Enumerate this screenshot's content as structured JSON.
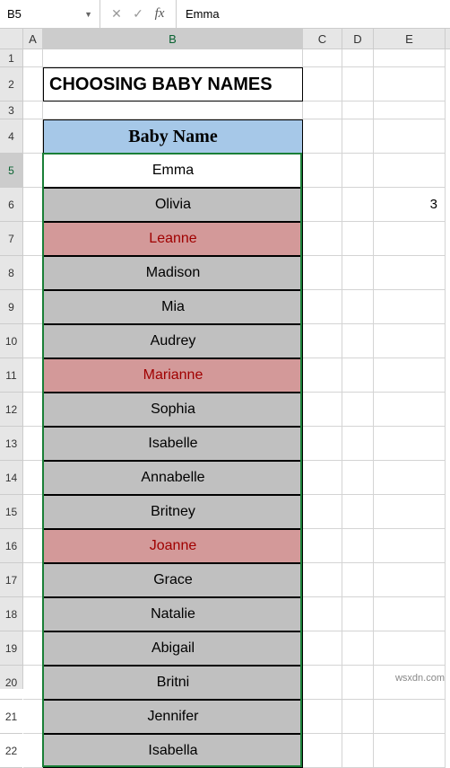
{
  "nameBox": "B5",
  "formulaValue": "Emma",
  "columns": [
    "A",
    "B",
    "C",
    "D",
    "E"
  ],
  "rowNumbers": [
    "1",
    "2",
    "3",
    "4",
    "5",
    "6",
    "7",
    "8",
    "9",
    "10",
    "11",
    "12",
    "13",
    "14",
    "15",
    "16",
    "17",
    "18",
    "19",
    "20",
    "21",
    "22"
  ],
  "title": "CHOOSING BABY NAMES",
  "header": "Baby Name",
  "names": [
    {
      "v": "Emma",
      "hl": false,
      "active": true
    },
    {
      "v": "Olivia",
      "hl": false
    },
    {
      "v": "Leanne",
      "hl": true
    },
    {
      "v": "Madison",
      "hl": false
    },
    {
      "v": "Mia",
      "hl": false
    },
    {
      "v": "Audrey",
      "hl": false
    },
    {
      "v": "Marianne",
      "hl": true
    },
    {
      "v": "Sophia",
      "hl": false
    },
    {
      "v": "Isabelle",
      "hl": false
    },
    {
      "v": "Annabelle",
      "hl": false
    },
    {
      "v": "Britney",
      "hl": false
    },
    {
      "v": "Joanne",
      "hl": true
    },
    {
      "v": "Grace",
      "hl": false
    },
    {
      "v": "Natalie",
      "hl": false
    },
    {
      "v": "Abigail",
      "hl": false
    },
    {
      "v": "Britni",
      "hl": false
    },
    {
      "v": "Jennifer",
      "hl": false
    },
    {
      "v": "Isabella",
      "hl": false
    }
  ],
  "sideValue": "3",
  "watermark": "wsxdn.com",
  "chart_data": {
    "type": "table",
    "title": "CHOOSING BABY NAMES",
    "columns": [
      "Baby Name"
    ],
    "rows": [
      [
        "Emma"
      ],
      [
        "Olivia"
      ],
      [
        "Leanne"
      ],
      [
        "Madison"
      ],
      [
        "Mia"
      ],
      [
        "Audrey"
      ],
      [
        "Marianne"
      ],
      [
        "Sophia"
      ],
      [
        "Isabelle"
      ],
      [
        "Annabelle"
      ],
      [
        "Britney"
      ],
      [
        "Joanne"
      ],
      [
        "Grace"
      ],
      [
        "Natalie"
      ],
      [
        "Abigail"
      ],
      [
        "Britni"
      ],
      [
        "Jennifer"
      ],
      [
        "Isabella"
      ]
    ],
    "highlighted_rows": [
      2,
      6,
      11
    ],
    "aux_value_E6": 3
  }
}
